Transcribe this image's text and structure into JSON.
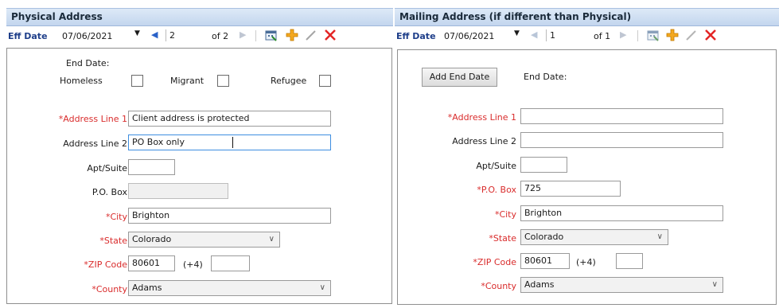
{
  "physical": {
    "title": "Physical Address",
    "eff_date_label": "Eff Date",
    "eff_date": "07/06/2021",
    "page": "2",
    "of_pages": "of 2",
    "end_date_label": "End Date:",
    "homeless_label": "Homeless",
    "migrant_label": "Migrant",
    "refugee_label": "Refugee",
    "address1_label": "*Address Line 1",
    "address1": "Client address is protected",
    "address2_label": "Address Line 2",
    "address2": "PO Box only",
    "apt_label": "Apt/Suite",
    "apt": "",
    "pobox_label": "P.O. Box",
    "pobox": "",
    "city_label": "*City",
    "city": "Brighton",
    "state_label": "*State",
    "state": "Colorado",
    "zip_label": "*ZIP Code",
    "zip": "80601",
    "plus4_label": "(+4)",
    "plus4": "",
    "county_label": "*County",
    "county": "Adams"
  },
  "mailing": {
    "title": "Mailing Address (if different than Physical)",
    "eff_date_label": "Eff Date",
    "eff_date": "07/06/2021",
    "page": "1",
    "of_pages": "of 1",
    "add_end_date_label": "Add End Date",
    "end_date_label": "End Date:",
    "address1_label": "*Address Line 1",
    "address1": "",
    "address2_label": "Address Line 2",
    "address2": "",
    "apt_label": "Apt/Suite",
    "apt": "",
    "pobox_label": "*P.O. Box",
    "pobox": "725",
    "city_label": "*City",
    "city": "Brighton",
    "state_label": "*State",
    "state": "Colorado",
    "zip_label": "*ZIP Code",
    "zip": "80601",
    "plus4_label": "(+4)",
    "plus4": "",
    "county_label": "*County",
    "county": "Adams"
  },
  "icons": {
    "dropdown": "▾",
    "prev": "◀",
    "next": "▶",
    "calendar": "calendar-icon",
    "add": "add-icon",
    "edit": "edit-icon",
    "delete": "delete-icon",
    "required_color": "#d92c2c",
    "label_accent_color": "#1f3f8a"
  }
}
